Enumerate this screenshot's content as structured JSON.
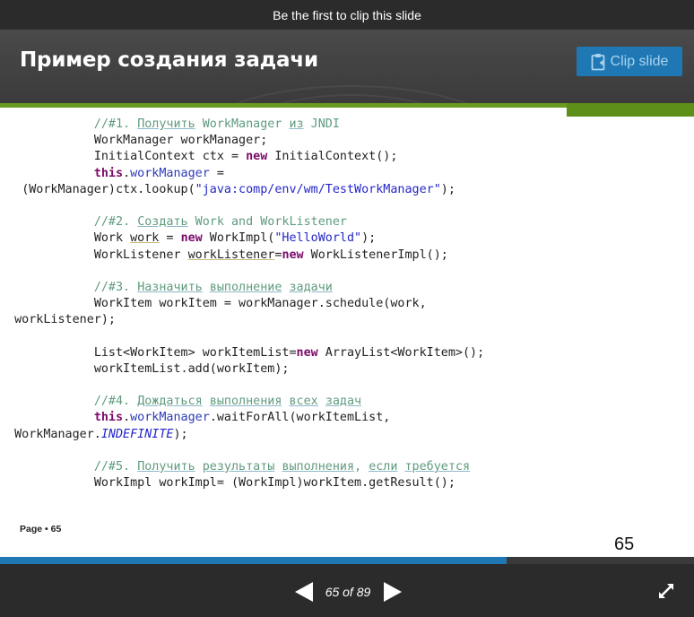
{
  "topbar": {
    "text": "Be the first to clip this slide"
  },
  "slide": {
    "title": "Пример создания задачи",
    "footer_label": "Page • 65",
    "number": "65",
    "code": {
      "s1_comment_a": "//#1. ",
      "s1_comment_b": "Получить",
      "s1_comment_c": " WorkManager ",
      "s1_comment_d": "из",
      "s1_comment_e": " JNDI",
      "s1_l2": "WorkManager workManager;",
      "s1_l3_a": "InitialContext ctx = ",
      "s1_l3_kw": "new",
      "s1_l3_b": " InitialContext();",
      "s1_l4_kw": "this",
      "s1_l4_a": ".",
      "s1_l4_fld": "workManager",
      "s1_l4_b": " =",
      "s1_l5_a": "(WorkManager)ctx.lookup(",
      "s1_l5_str": "\"java:comp/env/wm/TestWorkManager\"",
      "s1_l5_b": ");",
      "s2_comment_a": "//#2. ",
      "s2_comment_b": "Создать",
      "s2_comment_c": " Work and WorkListener",
      "s2_l2_a": "Work ",
      "s2_l2_var": "work",
      "s2_l2_b": " = ",
      "s2_l2_kw": "new",
      "s2_l2_c": " WorkImpl(",
      "s2_l2_str": "\"HelloWorld\"",
      "s2_l2_d": ");",
      "s2_l3_a": "WorkListener ",
      "s2_l3_var": "workListener",
      "s2_l3_b": "=",
      "s2_l3_kw": "new",
      "s2_l3_c": " WorkListenerImpl();",
      "s3_comment_a": "//#3. ",
      "s3_comment_b": "Назначить",
      "s3_comment_c": " ",
      "s3_comment_d": "выполнение",
      "s3_comment_e": " ",
      "s3_comment_f": "задачи",
      "s3_l2": "WorkItem workItem = workManager.schedule(work,",
      "s3_l3": "workListener);",
      "s3_l4_a": "List<WorkItem> workItemList=",
      "s3_l4_kw": "new",
      "s3_l4_b": " ArrayList<WorkItem>();",
      "s3_l5": "workItemList.add(workItem);",
      "s4_comment_a": "//#4. ",
      "s4_comment_b": "Дождаться",
      "s4_comment_c": " ",
      "s4_comment_d": "выполнения",
      "s4_comment_e": " ",
      "s4_comment_f": "всех",
      "s4_comment_g": " ",
      "s4_comment_h": "задач",
      "s4_l2_kw": "this",
      "s4_l2_a": ".",
      "s4_l2_fld": "workManager",
      "s4_l2_b": ".waitForAll(workItemList,",
      "s4_l3_a": "WorkManager.",
      "s4_l3_it": "INDEFINITE",
      "s4_l3_b": ");",
      "s5_comment_a": "//#5. ",
      "s5_comment_b": "Получить",
      "s5_comment_c": " ",
      "s5_comment_d": "результаты",
      "s5_comment_e": " ",
      "s5_comment_f": "выполнения",
      "s5_comment_g": ", ",
      "s5_comment_h": "если",
      "s5_comment_i": " ",
      "s5_comment_j": "требуется",
      "s5_l2": "WorkImpl workImpl= (WorkImpl)workItem.getResult();"
    }
  },
  "clip_button": {
    "label": "Clip slide",
    "icon": "clipboard-icon"
  },
  "nav": {
    "counter": "65 of 89",
    "prev_icon": "triangle-left-icon",
    "next_icon": "triangle-right-icon",
    "fullscreen_icon": "expand-arrows-icon",
    "progress": 0.7303
  },
  "colors": {
    "accent": "#1f78b4",
    "header_bg": "#444444",
    "green": "#6a9a1f",
    "dark_bar": "#2b2b2b"
  }
}
